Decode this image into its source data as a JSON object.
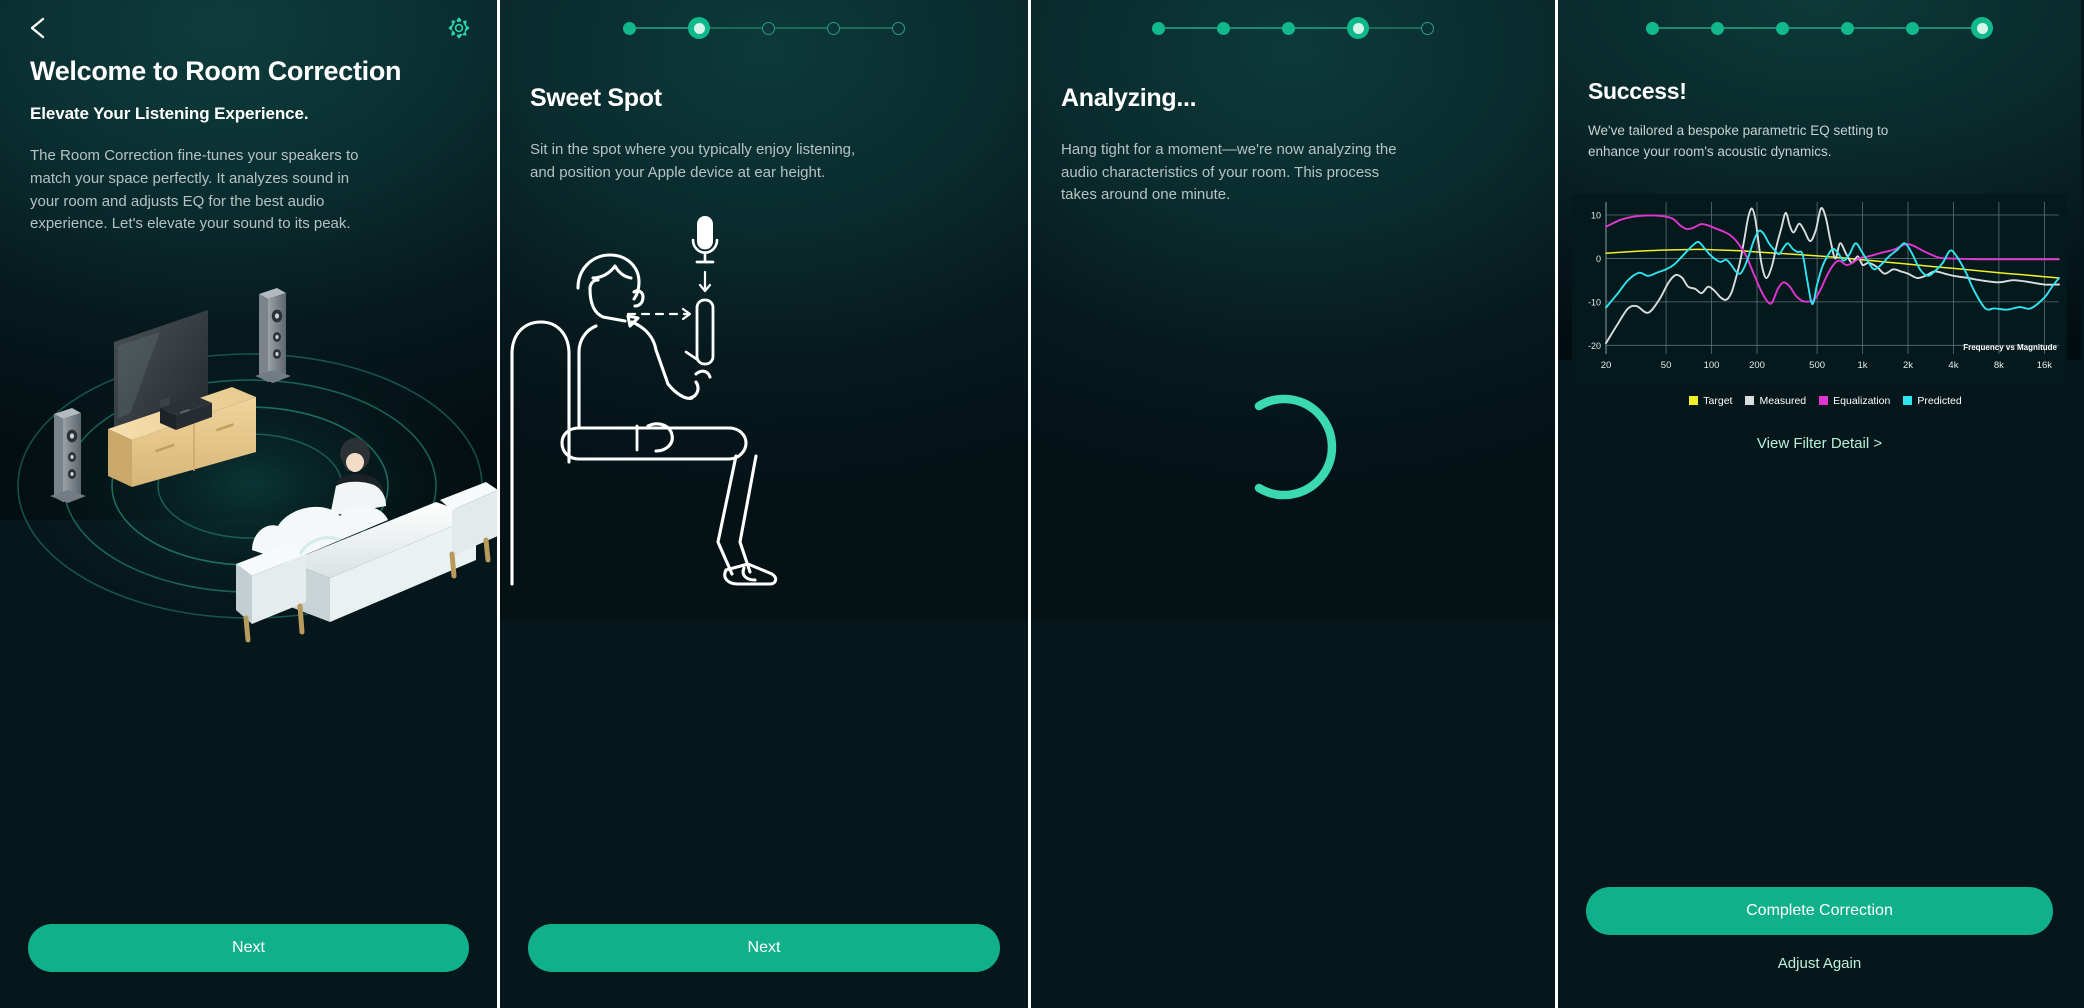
{
  "app": {
    "accent": "#0fb08a",
    "accent_light": "#2ce0b0",
    "background": "#06171b"
  },
  "panels": [
    {
      "id": "welcome",
      "topbar": {
        "back_icon": "chevron-left-icon",
        "settings_icon": "gear-icon"
      },
      "title": "Welcome to Room Correction",
      "subtitle": "Elevate Your Listening Experience.",
      "body": "The Room Correction fine-tunes your speakers to match your space perfectly. It analyzes sound in your room and adjusts EQ for the best audio experience. Let's elevate your sound to its peak.",
      "illustration": "isometric-living-room",
      "primary_button": "Next"
    },
    {
      "id": "sweet-spot",
      "stepper": {
        "total": 5,
        "current_index": 1,
        "states": [
          "done",
          "active",
          "todo",
          "todo",
          "todo"
        ]
      },
      "title": "Sweet Spot",
      "body": "Sit in the spot where you typically enjoy listening, and position your Apple device at ear height.",
      "illustration": "person-seated-with-phone-and-microphone",
      "primary_button": "Next"
    },
    {
      "id": "analyzing",
      "stepper": {
        "total": 6,
        "current_index": 4,
        "states": [
          "done",
          "done",
          "done",
          "active",
          "todo"
        ]
      },
      "title": "Analyzing...",
      "body": "Hang tight for a moment—we're now analyzing the audio characteristics of your room. This process takes around one minute.",
      "illustration": "loading-spinner-arc"
    },
    {
      "id": "success",
      "stepper": {
        "total": 6,
        "current_index": 5,
        "states": [
          "done",
          "done",
          "done",
          "done",
          "done",
          "active"
        ]
      },
      "title": "Success!",
      "body": "We've tailored a bespoke parametric EQ setting to enhance your room's acoustic dynamics.",
      "filter_link": "View Filter Detail >",
      "primary_button": "Complete Correction",
      "secondary_button": "Adjust Again"
    }
  ],
  "chart_data": {
    "type": "line",
    "title": "Frequency vs Magnitude",
    "xlabel": "",
    "ylabel": "",
    "xscale": "log",
    "x_ticks": [
      "20",
      "50",
      "100",
      "200",
      "500",
      "1k",
      "2k",
      "4k",
      "8k",
      "16k"
    ],
    "x_tick_hz": [
      20,
      50,
      100,
      200,
      500,
      1000,
      2000,
      4000,
      8000,
      16000
    ],
    "y_ticks": [
      "10",
      "0",
      "-10",
      "-20"
    ],
    "y_tick_values": [
      10,
      0,
      -10,
      -20
    ],
    "ylim": [
      -22,
      13
    ],
    "xlim": [
      20,
      20000
    ],
    "grid": true,
    "legend_position": "bottom",
    "series": [
      {
        "name": "Target",
        "color": "#f2f02a",
        "x": [
          20,
          30,
          45,
          60,
          80,
          100,
          150,
          200,
          300,
          500,
          700,
          1000,
          1500,
          2000,
          3000,
          5000,
          8000,
          12000,
          16000,
          20000
        ],
        "y": [
          1.2,
          1.6,
          1.9,
          2.0,
          2.1,
          2.0,
          1.8,
          1.5,
          1.1,
          0.6,
          0.2,
          -0.3,
          -0.9,
          -1.3,
          -1.9,
          -2.6,
          -3.3,
          -3.8,
          -4.2,
          -4.5
        ]
      },
      {
        "name": "Measured",
        "color": "#d9dde0",
        "x": [
          20,
          24,
          28,
          32,
          38,
          45,
          52,
          58,
          64,
          70,
          78,
          86,
          95,
          105,
          115,
          125,
          135,
          145,
          155,
          165,
          175,
          185,
          195,
          205,
          215,
          230,
          250,
          270,
          290,
          310,
          330,
          350,
          380,
          410,
          450,
          490,
          530,
          570,
          610,
          660,
          710,
          780,
          850,
          930,
          1000,
          1100,
          1250,
          1400,
          1600,
          1800,
          2000,
          2300,
          2600,
          3000,
          3500,
          4000,
          5000,
          6000,
          8000,
          10000,
          13000,
          16000,
          20000
        ],
        "y": [
          -19.5,
          -15.0,
          -11.5,
          -11.0,
          -12.5,
          -9.5,
          -5.5,
          -3.8,
          -4.5,
          -6.5,
          -7.0,
          -8.0,
          -6.5,
          -7.5,
          -9.0,
          -9.5,
          -8.0,
          -4.5,
          -0.5,
          4.5,
          9.5,
          11.5,
          9.0,
          3.5,
          -1.5,
          -4.5,
          -2.0,
          3.0,
          7.0,
          10.5,
          7.5,
          6.0,
          8.0,
          6.5,
          4.0,
          6.5,
          11.5,
          9.5,
          4.5,
          0.0,
          3.5,
          1.0,
          -1.0,
          0.5,
          -1.5,
          -1.0,
          -2.0,
          -3.5,
          -2.5,
          -3.0,
          -3.5,
          -4.5,
          -4.0,
          -3.0,
          -3.5,
          -4.0,
          -4.5,
          -5.0,
          -5.5,
          -5.0,
          -5.5,
          -6.0,
          -6.0
        ]
      },
      {
        "name": "Equalization",
        "color": "#e035d0",
        "x": [
          20,
          25,
          30,
          38,
          46,
          55,
          62,
          68,
          75,
          85,
          95,
          105,
          120,
          135,
          150,
          170,
          190,
          210,
          230,
          250,
          275,
          300,
          330,
          360,
          400,
          440,
          480,
          530,
          580,
          640,
          700,
          780,
          860,
          950,
          1100,
          1300,
          1600,
          2000,
          2600,
          3200,
          3800,
          4600,
          6000,
          8000,
          12000,
          16000,
          20000
        ],
        "y": [
          7.3,
          8.9,
          9.6,
          9.9,
          9.8,
          9.2,
          7.6,
          6.8,
          7.0,
          7.9,
          7.6,
          7.0,
          6.2,
          5.2,
          3.5,
          0.5,
          -3.5,
          -7.0,
          -9.5,
          -10.3,
          -7.0,
          -5.5,
          -6.5,
          -8.5,
          -9.8,
          -9.9,
          -9.5,
          -7.0,
          -4.0,
          -1.5,
          -0.5,
          -1.5,
          -1.0,
          0.0,
          0.5,
          1.2,
          2.0,
          3.3,
          1.5,
          0.2,
          0.0,
          -0.1,
          -0.2,
          -0.2,
          -0.2,
          -0.2,
          -0.2
        ]
      },
      {
        "name": "Predicted",
        "color": "#30e4ef",
        "x": [
          20,
          24,
          28,
          33,
          38,
          44,
          50,
          56,
          62,
          68,
          75,
          82,
          90,
          98,
          106,
          115,
          125,
          135,
          145,
          155,
          165,
          178,
          190,
          205,
          220,
          240,
          260,
          280,
          300,
          320,
          345,
          370,
          400,
          430,
          465,
          500,
          540,
          585,
          635,
          690,
          750,
          820,
          900,
          990,
          1100,
          1200,
          1350,
          1500,
          1700,
          1900,
          2100,
          2400,
          2700,
          3000,
          3400,
          3800,
          4200,
          4800,
          5500,
          6500,
          7500,
          9000,
          11000,
          13000,
          16000,
          18000,
          20000
        ],
        "y": [
          -11.3,
          -8.0,
          -5.0,
          -3.3,
          -4.0,
          -3.2,
          -2.5,
          -1.5,
          0.0,
          1.5,
          3.0,
          3.8,
          2.3,
          0.8,
          -0.2,
          -0.8,
          -0.3,
          -1.5,
          -3.0,
          -3.5,
          -2.0,
          1.0,
          4.0,
          6.3,
          5.8,
          3.5,
          2.0,
          1.0,
          2.5,
          3.5,
          2.2,
          1.5,
          1.0,
          -5.0,
          -10.5,
          -6.0,
          -2.0,
          0.5,
          2.2,
          1.2,
          -0.5,
          1.0,
          3.5,
          1.5,
          -1.0,
          -2.5,
          -1.2,
          0.5,
          2.0,
          3.5,
          1.5,
          -2.5,
          -4.0,
          -3.0,
          -1.0,
          1.8,
          0.5,
          -3.0,
          -7.5,
          -11.5,
          -11.5,
          -11.8,
          -11.2,
          -11.5,
          -9.0,
          -6.5,
          -4.5
        ]
      }
    ]
  }
}
